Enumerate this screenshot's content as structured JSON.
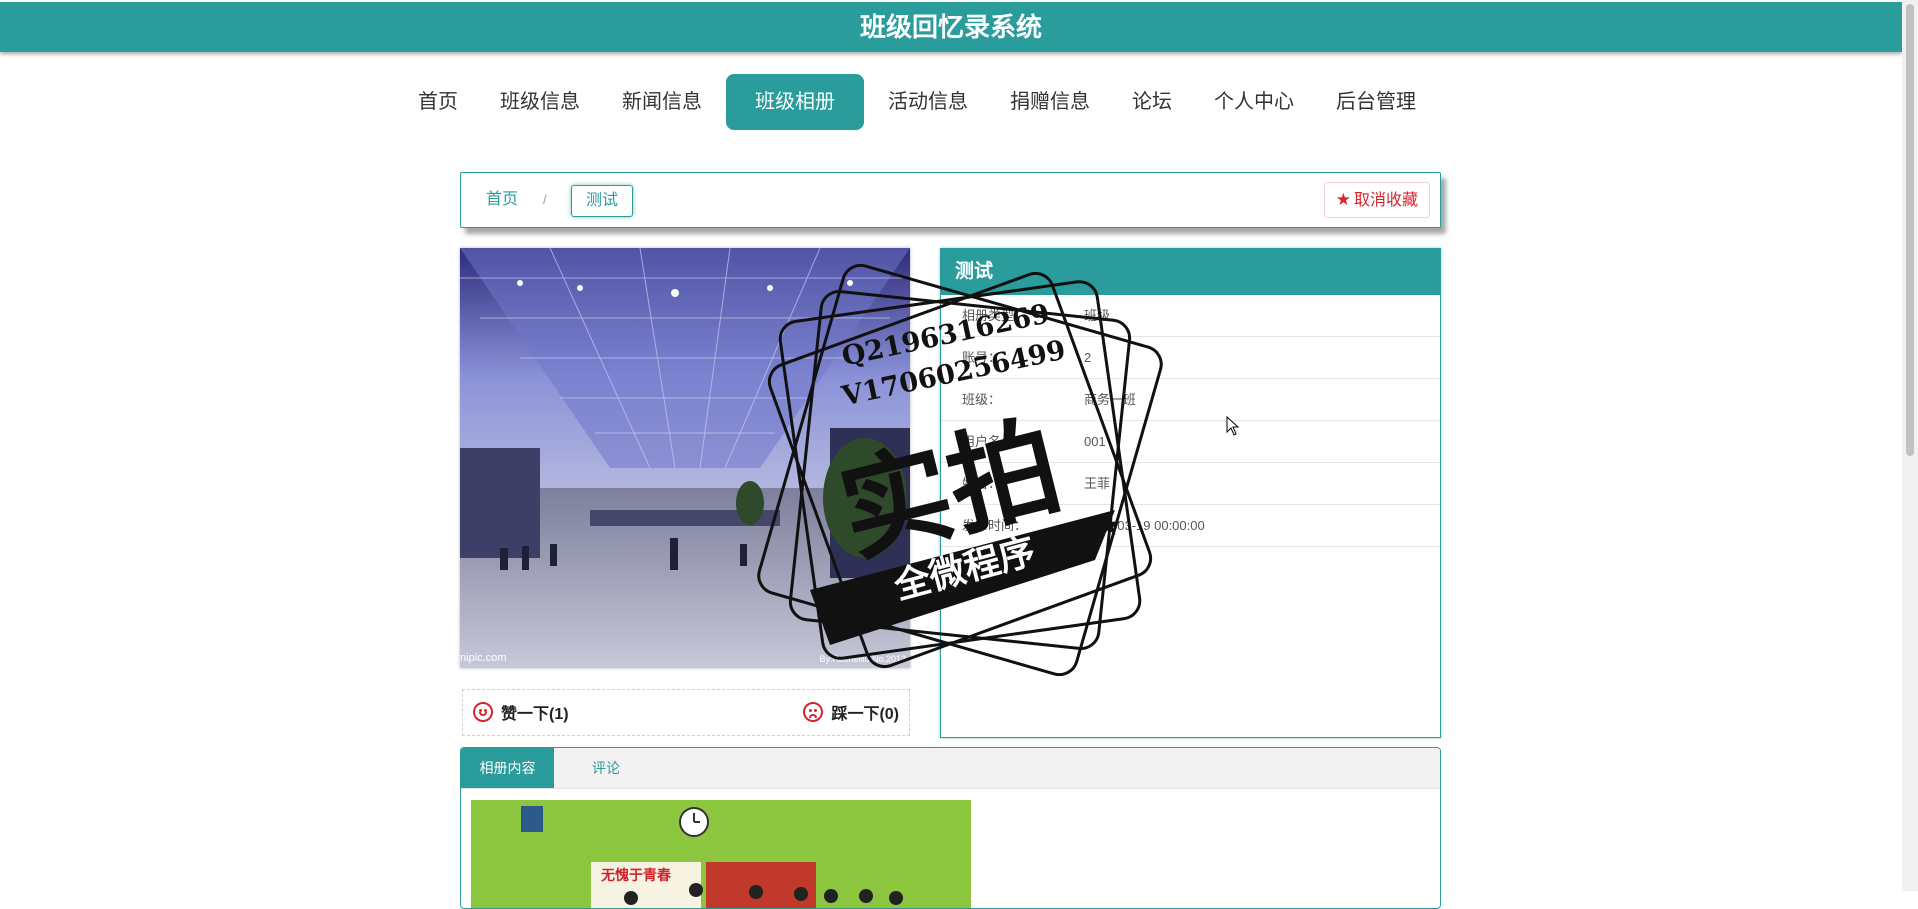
{
  "header": {
    "title": "班级回忆录系统"
  },
  "nav": {
    "items": [
      {
        "label": "首页",
        "active": false
      },
      {
        "label": "班级信息",
        "active": false
      },
      {
        "label": "新闻信息",
        "active": false
      },
      {
        "label": "班级相册",
        "active": true
      },
      {
        "label": "活动信息",
        "active": false
      },
      {
        "label": "捐赠信息",
        "active": false
      },
      {
        "label": "论坛",
        "active": false
      },
      {
        "label": "个人中心",
        "active": false
      },
      {
        "label": "后台管理",
        "active": false
      }
    ]
  },
  "breadcrumb": {
    "home": "首页",
    "separator": "/",
    "current": "测试"
  },
  "favorite": {
    "icon": "star-icon",
    "label": "取消收藏",
    "color": "#d9232d"
  },
  "photo": {
    "credit_left": "nipic.com",
    "credit_right": "By:Rachelliu  No.2012"
  },
  "votes": {
    "up": {
      "icon": "smile-icon",
      "label": "赞一下(1)"
    },
    "down": {
      "icon": "frown-icon",
      "label": "踩一下(0)"
    }
  },
  "info": {
    "title": "测试",
    "rows": [
      {
        "label": "相册类型：",
        "value": "班级"
      },
      {
        "label": "账号：",
        "value": "2"
      },
      {
        "label": "班级：",
        "value": "商务一班"
      },
      {
        "label": "用户名：",
        "value": "001"
      },
      {
        "label": "姓名：",
        "value": "王菲"
      },
      {
        "label": "发布时间：",
        "value": "2021-03-19 00:00:00"
      }
    ]
  },
  "tabs": [
    {
      "label": "相册内容",
      "active": true
    },
    {
      "label": "评论",
      "active": false
    }
  ],
  "content_photo": {
    "banner_text": "无愧于青春"
  },
  "watermark": {
    "line1": "Q2196316269",
    "line2": "V17060256499",
    "main": "实拍",
    "ribbon": "全微程序"
  },
  "colors": {
    "accent": "#2a9c9c",
    "danger": "#d9232d"
  }
}
